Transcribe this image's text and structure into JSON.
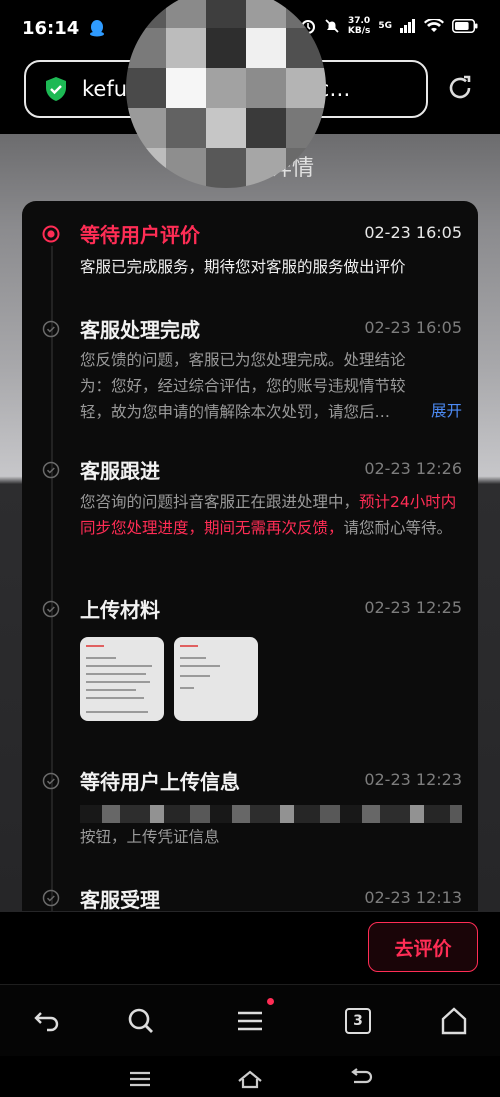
{
  "status_bar": {
    "time": "16:14",
    "net_speed_value": "37.0",
    "net_speed_unit": "KB/s",
    "signal_label": "5G",
    "battery_level": 0.8
  },
  "address_bar": {
    "url_prefix": "kefu",
    "url_suffix": "servic…"
  },
  "page": {
    "title_fragment": "详情"
  },
  "timeline": {
    "items": [
      {
        "title": "等待用户评价",
        "time": "02-23 16:05",
        "desc": "客服已完成服务，期待您对客服的服务做出评价",
        "active": true
      },
      {
        "title": "客服处理完成",
        "time": "02-23 16:05",
        "desc": "您反馈的问题，客服已为您处理完成。处理结论为：您好，经过综合评估，您的账号违规情节较轻，故为您申请的情解除本次处罚，请您后…",
        "expand_label": "展开"
      },
      {
        "title": "客服跟进",
        "time": "02-23 12:26",
        "desc_before": "您咨询的问题抖音客服正在跟进处理中，",
        "desc_highlight": "预计24小时内同步您处理进度，期间无需再次反馈，",
        "desc_after": "请您耐心等待。"
      },
      {
        "title": "上传材料",
        "time": "02-23 12:25"
      },
      {
        "title": "等待用户上传信息",
        "time": "02-23 12:23",
        "desc": "按钮，上传凭证信息"
      },
      {
        "title": "客服受理",
        "time": "02-23 12:13"
      }
    ]
  },
  "actions": {
    "evaluate_label": "去评价"
  },
  "browser_nav": {
    "tab_count": "3"
  },
  "colors": {
    "accent": "#ff2d55",
    "link": "#4d8bf5",
    "shield": "#1db954"
  }
}
